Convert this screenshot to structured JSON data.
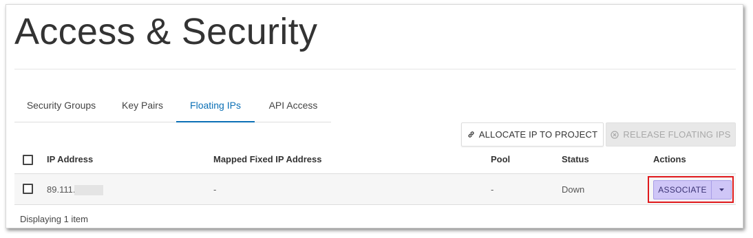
{
  "page": {
    "title": "Access & Security"
  },
  "tabs": [
    {
      "label": "Security Groups"
    },
    {
      "label": "Key Pairs"
    },
    {
      "label": "Floating IPs",
      "active": true
    },
    {
      "label": "API Access"
    }
  ],
  "toolbar": {
    "allocate_label": "ALLOCATE IP TO PROJECT",
    "allocate_icon": "link-icon",
    "release_label": "RELEASE FLOATING IPS",
    "release_icon": "circle-x-icon",
    "release_disabled": true
  },
  "table": {
    "columns": [
      "IP Address",
      "Mapped Fixed IP Address",
      "Pool",
      "Status",
      "Actions"
    ],
    "rows": [
      {
        "ip_address": "89.111.",
        "mapped_fixed_ip": "-",
        "pool": "-",
        "status": "Down",
        "action_label": "ASSOCIATE"
      }
    ]
  },
  "footer": {
    "count_text": "Displaying 1 item"
  },
  "colors": {
    "accent": "#0a6fb5",
    "associate_bg": "#cfc6f7",
    "highlight_border": "#e0181b"
  }
}
